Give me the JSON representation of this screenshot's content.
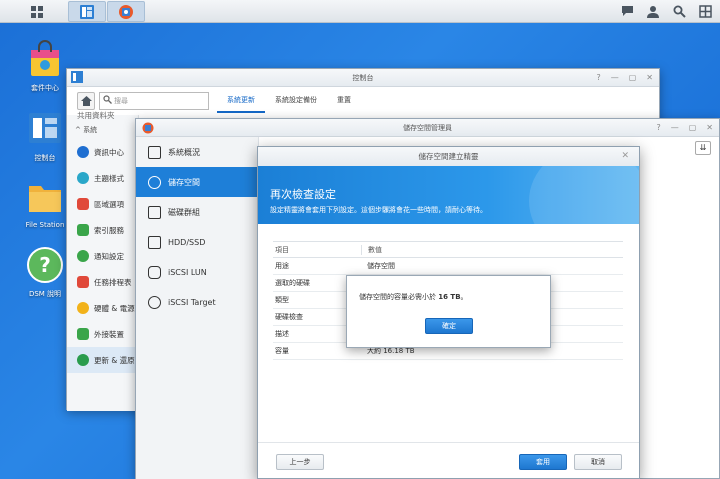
{
  "taskbar": {},
  "desktop": {
    "icons": [
      {
        "label": "套件中心"
      },
      {
        "label": "控制台"
      },
      {
        "label": "File Station"
      },
      {
        "label": "DSM 說明"
      }
    ]
  },
  "control_panel": {
    "title": "控制台",
    "search_placeholder": "搜尋",
    "tabs": [
      "系統更新",
      "系統設定備份",
      "重置"
    ],
    "section_label": "系統",
    "top_partial": "共用資料夾",
    "items": [
      {
        "label": "資訊中心",
        "color": "#1f6fd1"
      },
      {
        "label": "主題樣式",
        "color": "#2aa7c9"
      },
      {
        "label": "區域選項",
        "color": "#e0493a"
      },
      {
        "label": "索引服務",
        "color": "#3aa54a"
      },
      {
        "label": "通知設定",
        "color": "#3aa54a"
      },
      {
        "label": "任務排程表",
        "color": "#e0493a"
      },
      {
        "label": "硬體 & 電源",
        "color": "#f2b21a"
      },
      {
        "label": "外接裝置",
        "color": "#3aa54a"
      },
      {
        "label": "更新 & 還原",
        "color": "#2a9c4d"
      }
    ]
  },
  "storage_manager": {
    "title": "儲存空間管理員",
    "nav": [
      "系統概況",
      "儲存空間",
      "磁碟群組",
      "HDD/SSD",
      "iSCSI LUN",
      "iSCSI Target"
    ],
    "active_index": 1
  },
  "wizard": {
    "title": "儲存空間建立精靈",
    "heading": "再次檢查設定",
    "subheading": "設定精靈將會套用下列設定。這個步驟將會花一些時間，請耐心等待。",
    "table_header": {
      "item": "項目",
      "value": "數值"
    },
    "rows": [
      {
        "item": "用途",
        "value": "儲存空間"
      },
      {
        "item": "選取的硬碟",
        "value": ""
      },
      {
        "item": "類型",
        "value": ""
      },
      {
        "item": "硬碟檢查",
        "value": ""
      },
      {
        "item": "描述",
        "value": ""
      },
      {
        "item": "容量",
        "value": "大約 16.18 TB"
      }
    ],
    "back_button": "上一步",
    "apply_button": "套用",
    "cancel_button": "取消"
  },
  "alert": {
    "message_prefix": "儲存空間的容量必需小於 ",
    "message_value": "16 TB",
    "message_suffix": "。",
    "ok_button": "確定"
  }
}
